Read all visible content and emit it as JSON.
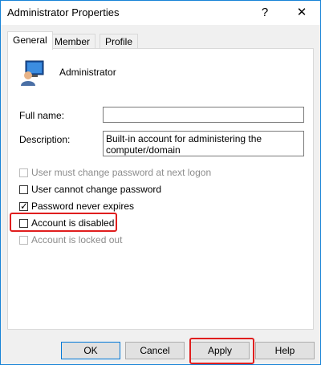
{
  "window": {
    "title": "Administrator Properties",
    "help_glyph": "?",
    "close_glyph": "✕"
  },
  "tabs": [
    {
      "label": "General",
      "active": true
    },
    {
      "label": "Member Of",
      "active": false
    },
    {
      "label": "Profile",
      "active": false
    }
  ],
  "general": {
    "user_name": "Administrator",
    "full_name_label": "Full name:",
    "full_name_value": "",
    "description_label": "Description:",
    "description_value": "Built-in account for administering the computer/domain"
  },
  "checkboxes": [
    {
      "label": "User must change password at next logon",
      "checked": false,
      "disabled": true
    },
    {
      "label": "User cannot change password",
      "checked": false,
      "disabled": false
    },
    {
      "label": "Password never expires",
      "checked": true,
      "disabled": false
    },
    {
      "label": "Account is disabled",
      "checked": false,
      "disabled": false
    },
    {
      "label": "Account is locked out",
      "checked": false,
      "disabled": true
    }
  ],
  "check_glyph": "✓",
  "buttons": {
    "ok": "OK",
    "cancel": "Cancel",
    "apply": "Apply",
    "help": "Help"
  },
  "colors": {
    "highlight": "#e01e1e",
    "titlebar_border": "#1883d7"
  }
}
